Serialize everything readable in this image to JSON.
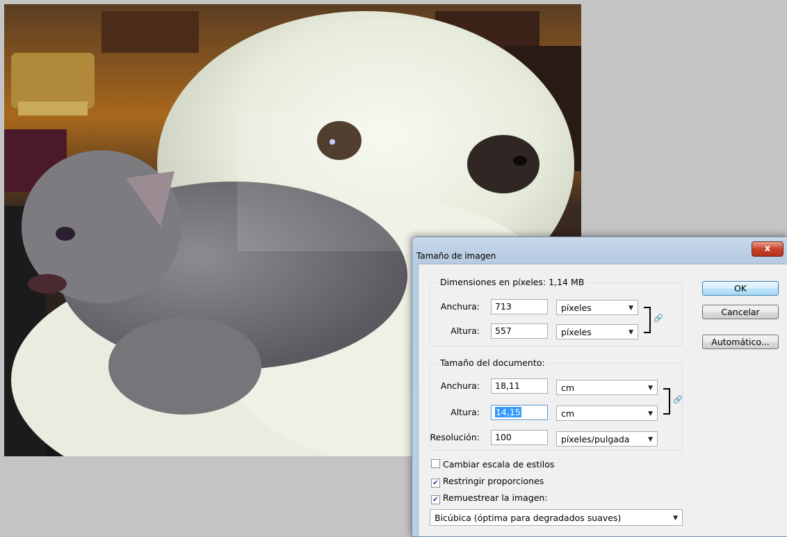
{
  "dialog": {
    "title": "Tamaño de imagen",
    "close_label": "x",
    "buttons": {
      "ok": "OK",
      "cancel": "Cancelar",
      "auto": "Automático..."
    },
    "pixel_dims": {
      "legend": "Dimensiones en píxeles:  1,14 MB",
      "width_label": "Anchura:",
      "width_value": "713",
      "width_unit": "píxeles",
      "height_label": "Altura:",
      "height_value": "557",
      "height_unit": "píxeles"
    },
    "doc_size": {
      "legend": "Tamaño del documento:",
      "width_label": "Anchura:",
      "width_value": "18,11",
      "width_unit": "cm",
      "height_label": "Altura:",
      "height_value": "14,15",
      "height_unit": "cm",
      "res_label": "Resolución:",
      "res_value": "100",
      "res_unit": "píxeles/pulgada"
    },
    "checkboxes": {
      "scale_styles": {
        "label": "Cambiar escala de estilos",
        "checked": false
      },
      "constrain": {
        "label": "Restringir proporciones",
        "checked": true
      },
      "resample": {
        "label": "Remuestrear la imagen:",
        "checked": true
      }
    },
    "resample_method": "Bicúbica (óptima para degradados suaves)"
  },
  "icons": {
    "chain": "link-icon",
    "dropdown": "chevron-down-icon",
    "close": "close-icon",
    "check": "checkmark-icon"
  }
}
